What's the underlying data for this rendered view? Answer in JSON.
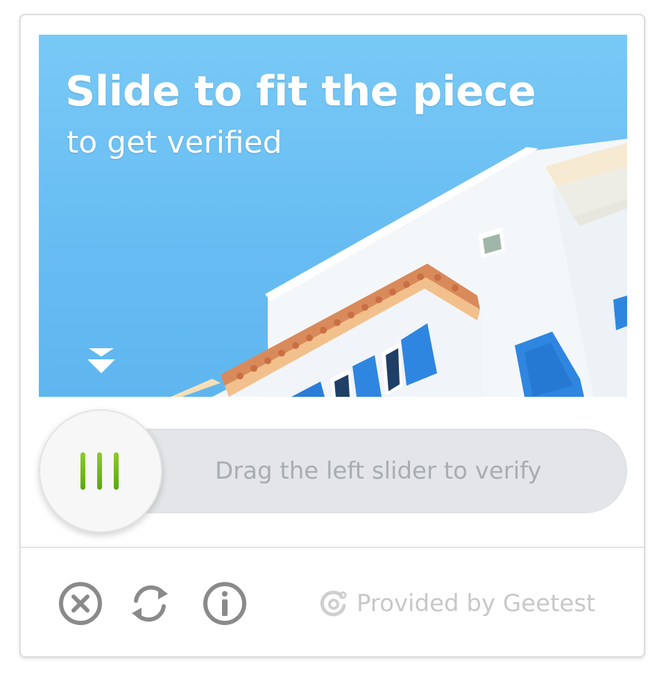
{
  "captcha": {
    "image": {
      "title": "Slide to fit the piece",
      "subtitle": "to get verified",
      "scene": "blue-sky-with-white-building",
      "marker_icon": "double-chevron-down-icon"
    },
    "slider": {
      "hint": "Drag the left slider to verify",
      "knob_icon": "grip-lines-icon"
    },
    "toolbar": {
      "close_icon": "close-circle-icon",
      "refresh_icon": "refresh-icon",
      "info_icon": "info-circle-icon"
    },
    "brand": {
      "text": "Provided by Geetest",
      "icon": "geetest-logo-icon"
    },
    "colors": {
      "sky": "#6ac0f3",
      "track": "#e3e5e8",
      "grip": "#6cb815",
      "hint_text": "#a8adb3",
      "icon_gray": "#8a8a8a",
      "brand_text": "#c8c8c8"
    }
  }
}
